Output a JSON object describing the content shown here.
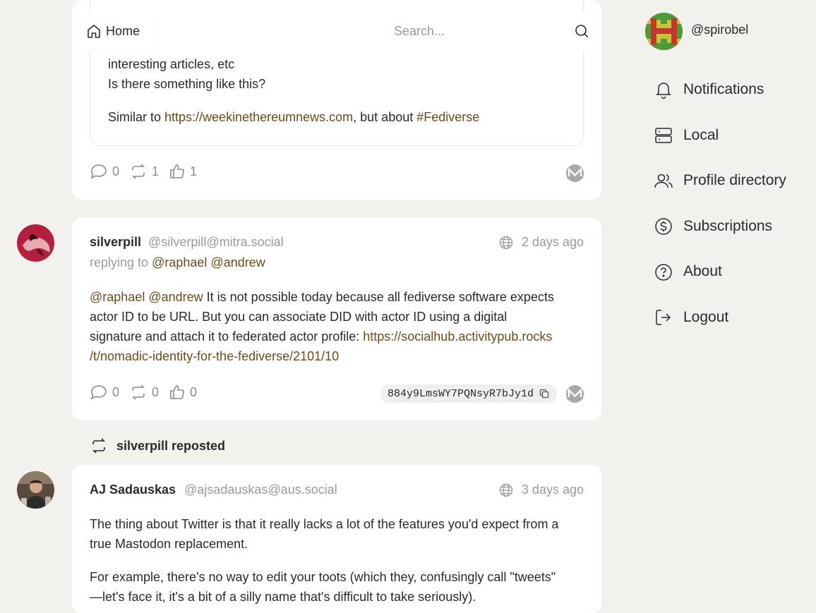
{
  "header": {
    "home_label": "Home",
    "search_placeholder": "Search..."
  },
  "sidebar": {
    "username": "@spirobel",
    "items": [
      {
        "label": "Notifications",
        "icon": "bell-icon"
      },
      {
        "label": "Local",
        "icon": "server-icon"
      },
      {
        "label": "Profile directory",
        "icon": "users-icon"
      },
      {
        "label": "Subscriptions",
        "icon": "dollar-circle-icon"
      },
      {
        "label": "About",
        "icon": "question-circle-icon"
      },
      {
        "label": "Logout",
        "icon": "logout-icon"
      }
    ]
  },
  "post1": {
    "quote_line1": "interesting articles, etc",
    "quote_line2": "Is there something like this?",
    "quote_line3_prefix": "Similar to ",
    "quote_link": "https://weekinethereumnews.com",
    "quote_line3_mid": ", but about ",
    "quote_hashtag": "#Fediverse",
    "replies": "0",
    "reposts": "1",
    "likes": "1"
  },
  "post2": {
    "author": "silverpill",
    "handle": "@silverpill@mitra.social",
    "time": "2 days ago",
    "replying_label": "replying to",
    "reply_mention1": "@raphael",
    "reply_mention2": "@andrew",
    "body_mention1": "@raphael",
    "body_mention2": "@andrew",
    "body_line1": " It is not possible today because all fediverse software expects",
    "body_line2": "actor ID to be  URL. But you can associate DID with actor ID using a digital",
    "body_line3_prefix": "signature and attach it to federated actor profile: ",
    "body_link_part1": "https://socialhub.activitypub.rocks",
    "body_link_part2": "/t/nomadic-identity-for-the-fediverse/2101/10",
    "replies": "0",
    "reposts": "0",
    "likes": "0",
    "code": "884y9LmsWY7PQNsyR7bJy1d"
  },
  "repost_banner": {
    "text": "silverpill reposted"
  },
  "post3": {
    "author": "AJ Sadauskas",
    "handle": "@ajsadauskas@aus.social",
    "time": "3 days ago",
    "line1": "The thing about Twitter is that it really lacks a lot of the features you'd expect from a",
    "line2": "true Mastodon replacement.",
    "line3": "For example, there's no way to edit your toots (which they, confusingly call \"tweets\"",
    "line4": "—let's face it, it's a bit of a silly name that's difficult to take seriously)."
  },
  "colors": {
    "background": "#f3f1ee",
    "card": "#ffffff",
    "link": "#6b4c1a",
    "muted": "#9a9a9a"
  }
}
